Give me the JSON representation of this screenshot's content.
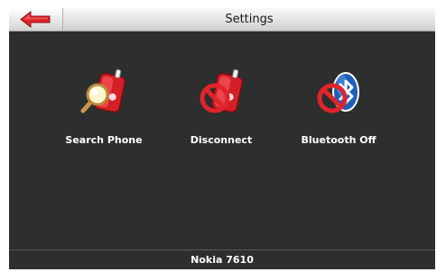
{
  "header": {
    "title": "Settings",
    "back_icon": "back-arrow-icon"
  },
  "actions": [
    {
      "label": "Search Phone",
      "icon": "search-phone-icon"
    },
    {
      "label": "Disconnect",
      "icon": "disconnect-icon"
    },
    {
      "label": "Bluetooth Off",
      "icon": "bluetooth-off-icon"
    }
  ],
  "footer": {
    "device_name": "Nokia 7610"
  },
  "colors": {
    "background": "#2d2f2e",
    "accent_red": "#e0242b",
    "text": "#ffffff"
  }
}
